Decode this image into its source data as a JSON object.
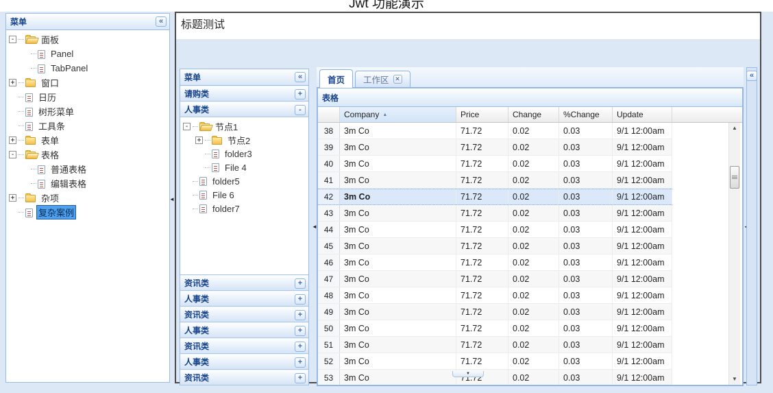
{
  "page": {
    "app_title": "Jwt 功能演示",
    "panel_title": "标题测试"
  },
  "west_panel": {
    "title": "菜单",
    "collapse_tool": "«",
    "tree": [
      {
        "label": "面板",
        "type": "folder-open",
        "expander": "minus",
        "level": 0
      },
      {
        "label": "Panel",
        "type": "leaf",
        "expander": null,
        "level": 1
      },
      {
        "label": "TabPanel",
        "type": "leaf",
        "expander": null,
        "level": 1
      },
      {
        "label": "窗口",
        "type": "folder",
        "expander": "plus",
        "level": 0
      },
      {
        "label": "日历",
        "type": "leaf",
        "expander": null,
        "level": 0
      },
      {
        "label": "树形菜单",
        "type": "leaf",
        "expander": null,
        "level": 0
      },
      {
        "label": "工具条",
        "type": "leaf",
        "expander": null,
        "level": 0
      },
      {
        "label": "表单",
        "type": "folder",
        "expander": "plus",
        "level": 0
      },
      {
        "label": "表格",
        "type": "folder-open",
        "expander": "minus",
        "level": 0
      },
      {
        "label": "普通表格",
        "type": "leaf",
        "expander": null,
        "level": 1
      },
      {
        "label": "编辑表格",
        "type": "leaf",
        "expander": null,
        "level": 1
      },
      {
        "label": "杂项",
        "type": "folder",
        "expander": "plus",
        "level": 0
      },
      {
        "label": "复杂案例",
        "type": "leaf",
        "expander": null,
        "level": 0,
        "selected": true
      }
    ]
  },
  "accordion": {
    "title": "菜单",
    "collapse_tool": "«",
    "sections_top": [
      {
        "label": "请购类",
        "tool": "+"
      },
      {
        "label": "人事类",
        "tool": "-"
      }
    ],
    "tree": [
      {
        "label": "节点1",
        "type": "folder-open",
        "expander": "minus",
        "level": 0
      },
      {
        "label": "节点2",
        "type": "folder",
        "expander": "plus",
        "level": 1
      },
      {
        "label": "folder3",
        "type": "leaf",
        "expander": null,
        "level": 1
      },
      {
        "label": "File 4",
        "type": "leaf",
        "expander": null,
        "level": 1
      },
      {
        "label": "folder5",
        "type": "leaf",
        "expander": null,
        "level": 0
      },
      {
        "label": "File 6",
        "type": "leaf",
        "expander": null,
        "level": 0
      },
      {
        "label": "folder7",
        "type": "leaf",
        "expander": null,
        "level": 0
      }
    ],
    "sections_bottom": [
      {
        "label": "资讯类",
        "tool": "+"
      },
      {
        "label": "人事类",
        "tool": "+"
      },
      {
        "label": "资讯类",
        "tool": "+"
      },
      {
        "label": "人事类",
        "tool": "+"
      },
      {
        "label": "资讯类",
        "tool": "+"
      },
      {
        "label": "人事类",
        "tool": "+"
      },
      {
        "label": "资讯类",
        "tool": "+"
      }
    ]
  },
  "tab_panel": {
    "tabs": [
      {
        "label": "首页",
        "active": true,
        "closable": false
      },
      {
        "label": "工作区",
        "active": false,
        "closable": true
      }
    ],
    "east_collapse_tool": "«"
  },
  "grid": {
    "title": "表格",
    "columns": [
      {
        "label": "",
        "width": 32,
        "sorted": null
      },
      {
        "label": "Company",
        "width": 170,
        "sorted": "asc"
      },
      {
        "label": "Price",
        "width": 76,
        "sorted": null
      },
      {
        "label": "Change",
        "width": 74,
        "sorted": null
      },
      {
        "label": "%Change",
        "width": 78,
        "sorted": null
      },
      {
        "label": "Update",
        "width": 87,
        "sorted": null
      }
    ],
    "rows": [
      {
        "num": "38",
        "company": "3m Co",
        "price": "71.72",
        "change": "0.02",
        "pct": "0.03",
        "update": "9/1 12:00am",
        "selected": false
      },
      {
        "num": "39",
        "company": "3m Co",
        "price": "71.72",
        "change": "0.02",
        "pct": "0.03",
        "update": "9/1 12:00am",
        "selected": false
      },
      {
        "num": "40",
        "company": "3m Co",
        "price": "71.72",
        "change": "0.02",
        "pct": "0.03",
        "update": "9/1 12:00am",
        "selected": false
      },
      {
        "num": "41",
        "company": "3m Co",
        "price": "71.72",
        "change": "0.02",
        "pct": "0.03",
        "update": "9/1 12:00am",
        "selected": false
      },
      {
        "num": "42",
        "company": "3m Co",
        "price": "71.72",
        "change": "0.02",
        "pct": "0.03",
        "update": "9/1 12:00am",
        "selected": true
      },
      {
        "num": "43",
        "company": "3m Co",
        "price": "71.72",
        "change": "0.02",
        "pct": "0.03",
        "update": "9/1 12:00am",
        "selected": false
      },
      {
        "num": "44",
        "company": "3m Co",
        "price": "71.72",
        "change": "0.02",
        "pct": "0.03",
        "update": "9/1 12:00am",
        "selected": false
      },
      {
        "num": "45",
        "company": "3m Co",
        "price": "71.72",
        "change": "0.02",
        "pct": "0.03",
        "update": "9/1 12:00am",
        "selected": false
      },
      {
        "num": "46",
        "company": "3m Co",
        "price": "71.72",
        "change": "0.02",
        "pct": "0.03",
        "update": "9/1 12:00am",
        "selected": false
      },
      {
        "num": "47",
        "company": "3m Co",
        "price": "71.72",
        "change": "0.02",
        "pct": "0.03",
        "update": "9/1 12:00am",
        "selected": false
      },
      {
        "num": "48",
        "company": "3m Co",
        "price": "71.72",
        "change": "0.02",
        "pct": "0.03",
        "update": "9/1 12:00am",
        "selected": false
      },
      {
        "num": "49",
        "company": "3m Co",
        "price": "71.72",
        "change": "0.02",
        "pct": "0.03",
        "update": "9/1 12:00am",
        "selected": false
      },
      {
        "num": "50",
        "company": "3m Co",
        "price": "71.72",
        "change": "0.02",
        "pct": "0.03",
        "update": "9/1 12:00am",
        "selected": false
      },
      {
        "num": "51",
        "company": "3m Co",
        "price": "71.72",
        "change": "0.02",
        "pct": "0.03",
        "update": "9/1 12:00am",
        "selected": false
      },
      {
        "num": "52",
        "company": "3m Co",
        "price": "71.72",
        "change": "0.02",
        "pct": "0.03",
        "update": "9/1 12:00am",
        "selected": false
      },
      {
        "num": "53",
        "company": "3m Co",
        "price": "71.72",
        "change": "0.02",
        "pct": "0.03",
        "update": "9/1 12:00am",
        "selected": false
      }
    ]
  }
}
